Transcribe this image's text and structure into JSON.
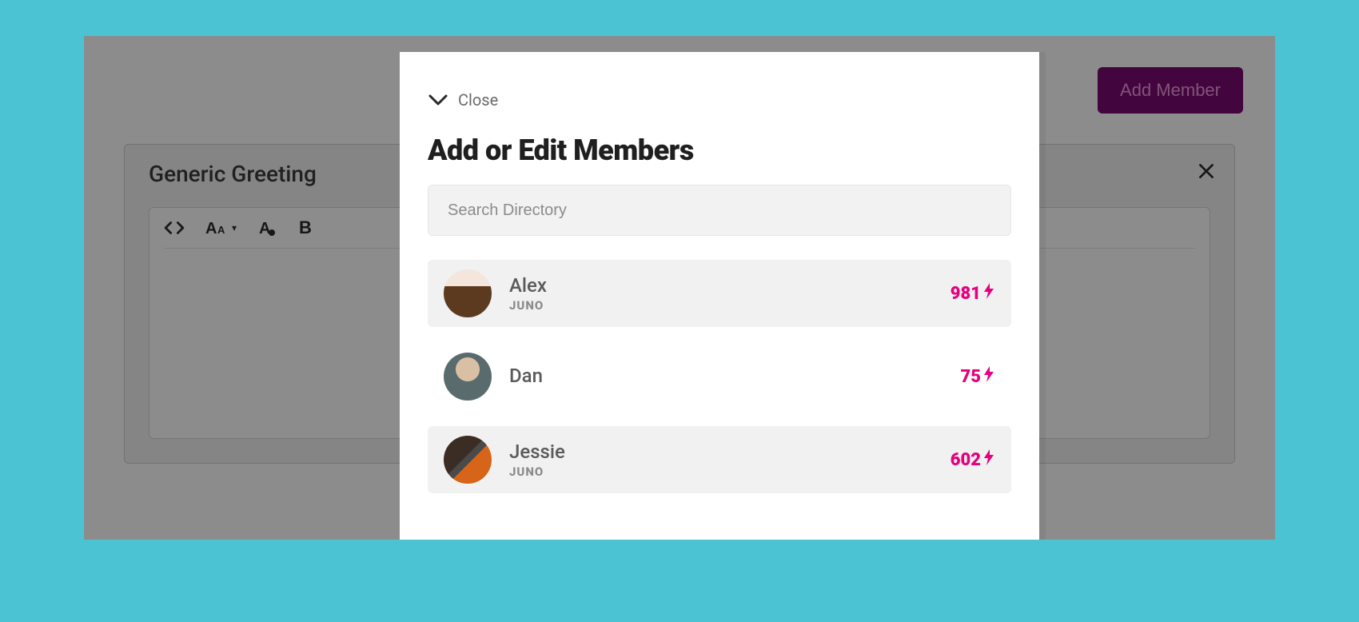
{
  "header": {
    "add_member_label": "Add Member"
  },
  "panel": {
    "title": "Generic Greeting"
  },
  "modal": {
    "close_label": "Close",
    "title": "Add or Edit Members",
    "search_placeholder": "Search Directory",
    "members": [
      {
        "name": "Alex",
        "org": "JUNO",
        "score": "981"
      },
      {
        "name": "Dan",
        "org": "",
        "score": "75"
      },
      {
        "name": "Jessie",
        "org": "JUNO",
        "score": "602"
      }
    ]
  },
  "colors": {
    "accent": "#e6007e",
    "brand_button_bg": "#7a0a6f",
    "frame_bg": "#4cc3d3"
  }
}
